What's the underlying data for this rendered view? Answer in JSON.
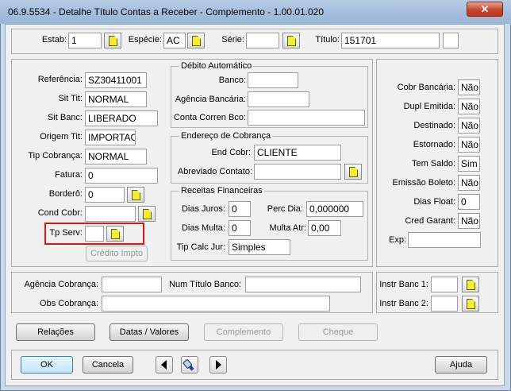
{
  "window": {
    "title": "06.9.5534 - Detalhe Título Contas a Receber - Complemento - 1.00.01.020",
    "close_label": "✕"
  },
  "header": {
    "estab_label": "Estab:",
    "estab_value": "1",
    "especie_label": "Espécie:",
    "especie_value": "AC",
    "serie_label": "Série:",
    "serie_value": "",
    "titulo_label": "Título:",
    "titulo_value": "151701",
    "titulo_extra": ""
  },
  "left": {
    "referencia_label": "Referência:",
    "referencia_value": "SZ30411001",
    "sit_tit_label": "Sit Tit:",
    "sit_tit_value": "NORMAL",
    "sit_banc_label": "Sit Banc:",
    "sit_banc_value": "LIBERADO",
    "origem_tit_label": "Origem Tit:",
    "origem_tit_value": "IMPORTAC",
    "tip_cobranca_label": "Tip Cobrança:",
    "tip_cobranca_value": "NORMAL",
    "fatura_label": "Fatura:",
    "fatura_value": "0",
    "bordero_label": "Borderô:",
    "bordero_value": "0",
    "cond_cobr_label": "Cond Cobr:",
    "cond_cobr_value": "",
    "tp_serv_label": "Tp Serv:",
    "tp_serv_value": "",
    "credito_impto_label": "Crédito Impto"
  },
  "debito": {
    "title": "Débito Automático",
    "banco_label": "Banco:",
    "banco_value": "",
    "agencia_label": "Agência Bancária:",
    "agencia_value": "",
    "conta_label": "Conta Corren Bco:",
    "conta_value": ""
  },
  "endereco": {
    "title": "Endereço de Cobrança",
    "end_cobr_label": "End Cobr:",
    "end_cobr_value": "CLIENTE",
    "abreviado_label": "Abreviado Contato:",
    "abreviado_value": ""
  },
  "receitas": {
    "title": "Receitas Financeiras",
    "dias_juros_label": "Dias Juros:",
    "dias_juros_value": "0",
    "perc_dia_label": "Perc Dia:",
    "perc_dia_value": "0,000000",
    "dias_multa_label": "Dias Multa:",
    "dias_multa_value": "0",
    "multa_atr_label": "Multa Atr:",
    "multa_atr_value": "0,00",
    "tip_calc_label": "Tip Calc Jur:",
    "tip_calc_value": "Simples"
  },
  "right": {
    "cobr_bancaria_label": "Cobr Bancária:",
    "cobr_bancaria_value": "Não",
    "dupl_emitida_label": "Dupl Emitida:",
    "dupl_emitida_value": "Não",
    "destinado_label": "Destinado:",
    "destinado_value": "Não",
    "estornado_label": "Estornado:",
    "estornado_value": "Não",
    "tem_saldo_label": "Tem Saldo:",
    "tem_saldo_value": "Sim",
    "emissao_boleto_label": "Emissão Boleto:",
    "emissao_boleto_value": "Não",
    "dias_float_label": "Dias Float:",
    "dias_float_value": "0",
    "cred_garant_label": "Cred Garant:",
    "cred_garant_value": "Não",
    "exp_label": "Exp:",
    "exp_value": ""
  },
  "bottom_panel": {
    "agencia_cobranca_label": "Agência Cobrança:",
    "agencia_cobranca_value": "",
    "num_titulo_banco_label": "Num Título Banco:",
    "num_titulo_banco_value": "",
    "obs_cobranca_label": "Obs Cobrança:",
    "obs_cobranca_value": "",
    "instr_banc1_label": "Instr Banc 1:",
    "instr_banc1_value": "",
    "instr_banc2_label": "Instr Banc 2:",
    "instr_banc2_value": ""
  },
  "tabs_buttons": {
    "relacoes": "Relações",
    "datas_valores": "Datas / Valores",
    "complemento": "Complemento",
    "cheque": "Cheque"
  },
  "footer": {
    "ok": "OK",
    "cancela": "Cancela",
    "ajuda": "Ajuda"
  },
  "colors": {
    "highlight": "#e0141c",
    "zoom_icon": "#f2ee2c",
    "window_frame": "#c9d9ea"
  }
}
